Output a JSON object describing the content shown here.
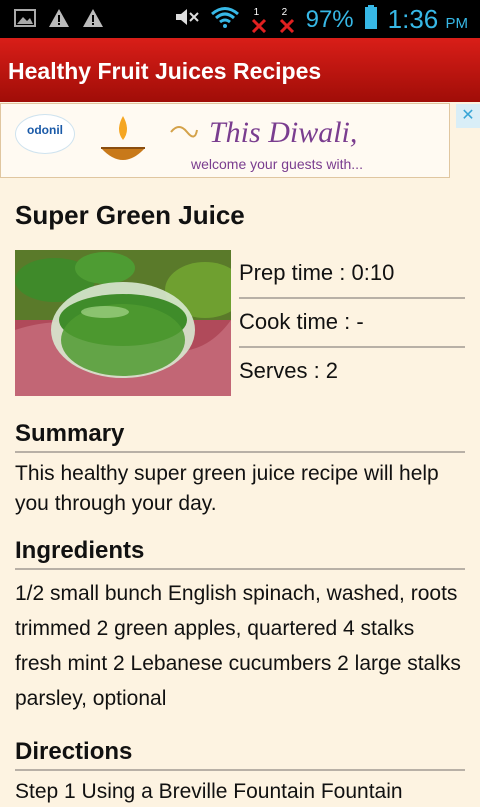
{
  "status_bar": {
    "battery_percent": "97%",
    "time": "1:36",
    "ampm": "PM",
    "sim1_label": "1",
    "sim2_label": "2"
  },
  "app_bar": {
    "title": "Healthy Fruit Juices Recipes"
  },
  "ad": {
    "logo_text": "odonil",
    "headline": "This Diwali,",
    "subline": "welcome your guests with...",
    "close_label": "✕"
  },
  "recipe": {
    "title": "Super Green Juice",
    "prep_time": "Prep time : 0:10",
    "cook_time": "Cook time : -",
    "serves": "Serves : 2",
    "summary_heading": "Summary",
    "summary_text": "This healthy super green juice recipe will help you through your day.",
    "ingredients_heading": "Ingredients",
    "ingredients_text": "1/2 small bunch English spinach, washed, roots trimmed 2 green apples, quartered 4 stalks fresh mint 2 Lebanese cucumbers 2 large stalks parsley, optional",
    "directions_heading": "Directions",
    "directions_text": "Step 1 Using a Breville Fountain Fountain"
  }
}
